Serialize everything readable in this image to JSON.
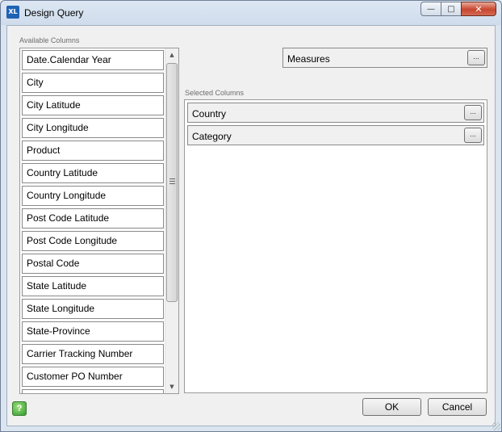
{
  "window": {
    "title": "Design Query",
    "app_icon_text": "XL",
    "controls": {
      "minimize": "—",
      "maximize": "□",
      "close": "✕"
    }
  },
  "available_columns": {
    "label": "Available Columns",
    "items": [
      "Date.Calendar Year",
      "City",
      "City Latitude",
      "City Longitude",
      "Product",
      "Country Latitude",
      "Country Longitude",
      "Post Code Latitude",
      "Post Code Longitude",
      "Postal Code",
      "State Latitude",
      "State Longitude",
      "State-Province",
      "Carrier Tracking Number",
      "Customer PO Number",
      ""
    ]
  },
  "measures": {
    "label": "Measures",
    "button": "..."
  },
  "selected_columns": {
    "label": "Selected Columns",
    "items": [
      {
        "label": "Country",
        "button": "..."
      },
      {
        "label": "Category",
        "button": "..."
      }
    ]
  },
  "footer": {
    "help": "?",
    "ok": "OK",
    "cancel": "Cancel"
  },
  "icons": {
    "scroll_up": "▲",
    "scroll_down": "▼"
  }
}
